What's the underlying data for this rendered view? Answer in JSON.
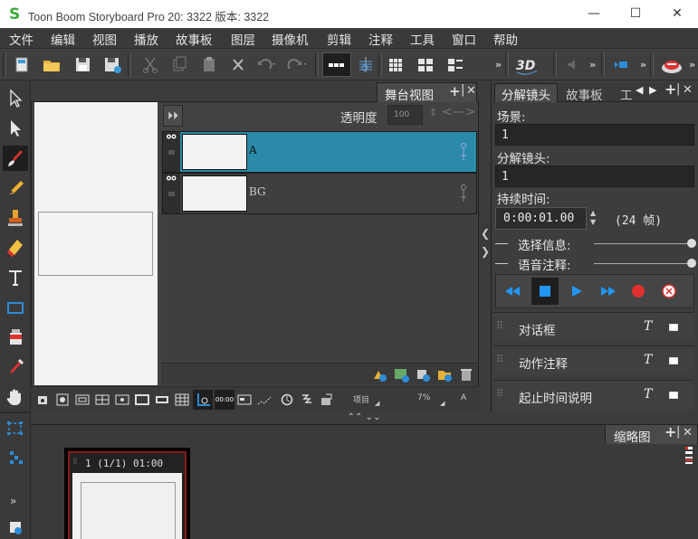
{
  "window": {
    "title": "Toon Boom Storyboard Pro 20:  3322 版本: 3322",
    "logo_letter": "S",
    "minimize": "—",
    "maximize": "☐",
    "close": "✕"
  },
  "menu": [
    "文件",
    "编辑",
    "视图",
    "播放",
    "故事板",
    "图层",
    "摄像机",
    "剪辑",
    "注释",
    "工具",
    "窗口",
    "帮助"
  ],
  "toolbar_icons": [
    "new-page-icon",
    "open-folder-icon",
    "save-icon",
    "save-as-icon",
    "cut-icon",
    "copy-icon",
    "paste-icon",
    "delete-icon",
    "undo-icon",
    "redo-icon",
    "text-frame-icon",
    "onion-skin-icon",
    "grid-icon",
    "layout-icon",
    "list-icon",
    "3d-icon",
    "sound-icon",
    "camera-icon",
    "record-icon"
  ],
  "stage": {
    "tab_label": "舞台视图",
    "opacity_label": "透明度",
    "opacity_value": "100",
    "layers": [
      {
        "name": "A",
        "selected": true
      },
      {
        "name": "BG",
        "selected": false
      }
    ]
  },
  "right_panel": {
    "tabs": [
      "分解镜头",
      "故事板",
      "工"
    ],
    "scene_label": "场景:",
    "scene_value": "1",
    "panel_label": "分解镜头:",
    "panel_value": "1",
    "duration_label": "持续时间:",
    "duration_value": "0:00:01.00",
    "duration_frames": "(24 帧)",
    "select_info": "选择信息:",
    "voice_note": "语音注释:",
    "sections": [
      "对话框",
      "动作注释",
      "起止时间说明"
    ]
  },
  "thumbnails": {
    "tab_label": "缩略图",
    "panel_caption": "1 (1/1) 01:00"
  },
  "colors": {
    "selected_layer": "#2a8aa8",
    "accent_blue": "#2196f3",
    "record_red": "#e03030",
    "thumbnail_border": "#8a1a1a"
  }
}
